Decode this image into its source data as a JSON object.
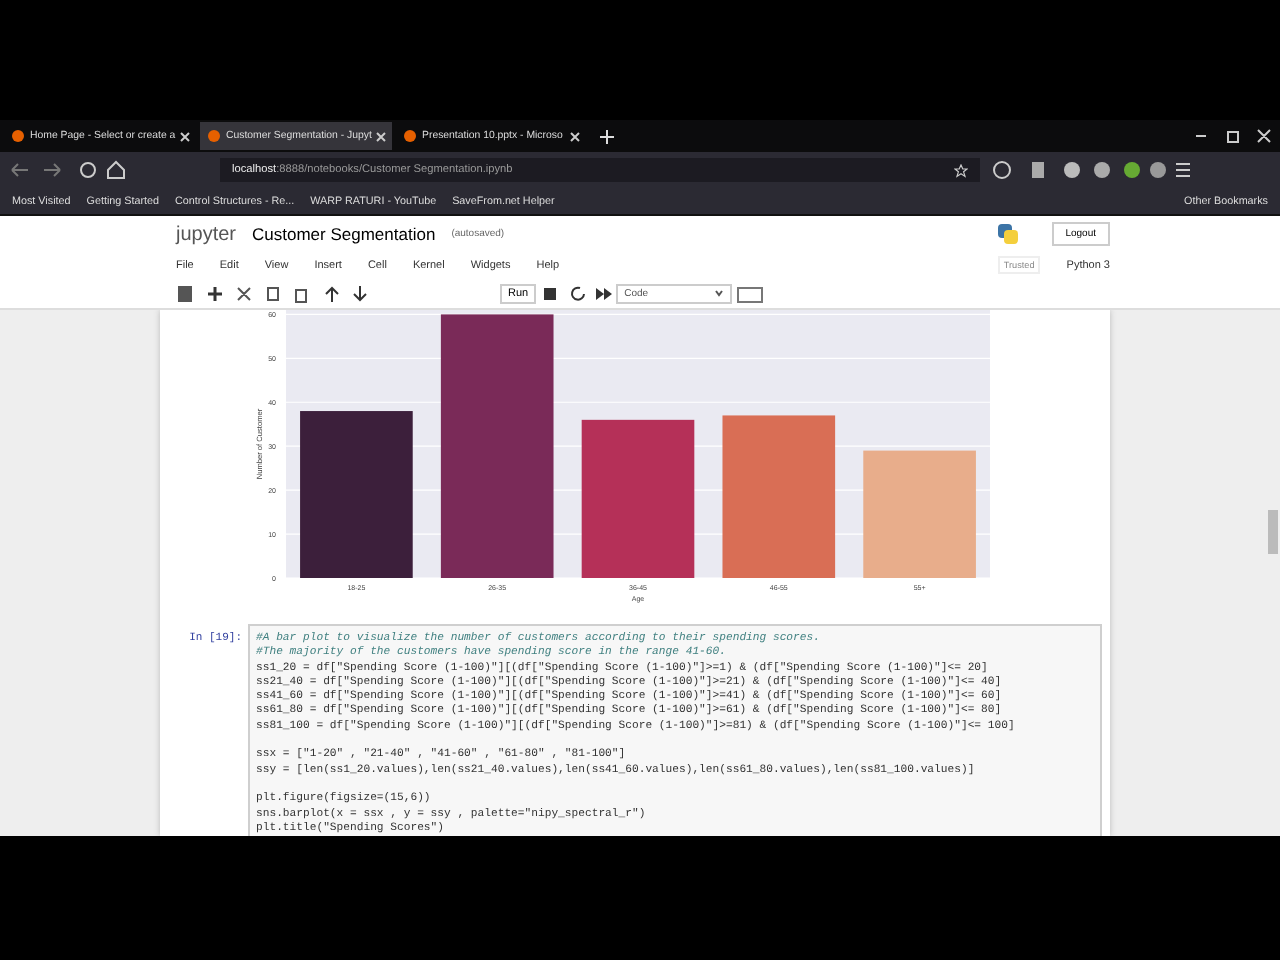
{
  "browser": {
    "tabs": [
      {
        "label": "Home Page - Select or create a",
        "selected": false
      },
      {
        "label": "Customer Segmentation - Jupyt",
        "selected": true
      },
      {
        "label": "Presentation 10.pptx - Microso",
        "selected": false
      }
    ],
    "address": {
      "host": "localhost",
      "path": ":8888/notebooks/Customer Segmentation.ipynb"
    },
    "bookmarks": [
      "Most Visited",
      "Getting Started",
      "Control Structures - Re...",
      "WARP RATURI - YouTube",
      "SaveFrom.net Helper"
    ],
    "other_bookmarks": "Other Bookmarks"
  },
  "jupyter": {
    "logo": "jupyter",
    "title": "Customer Segmentation",
    "autosave": "(autosaved)",
    "logout": "Logout",
    "menu": [
      "File",
      "Edit",
      "View",
      "Insert",
      "Cell",
      "Kernel",
      "Widgets",
      "Help"
    ],
    "run_label": "Run",
    "cell_type": "Code",
    "trusted": "Trusted",
    "kernel": "Python 3"
  },
  "output_chart": {
    "chart_data": {
      "type": "bar",
      "xlabel": "Age",
      "ylabel": "Number of Customer",
      "categories": [
        "18-25",
        "26-35",
        "36-45",
        "46-55",
        "55+"
      ],
      "values": [
        38,
        60,
        36,
        37,
        29
      ],
      "grid": true,
      "ylim": [
        0,
        61
      ],
      "yticks": [
        0,
        10,
        20,
        30,
        40,
        50,
        60
      ]
    }
  },
  "code_cell": {
    "prompt": "In [19]:",
    "lines": [
      {
        "kind": "comment",
        "text": "#A bar plot to visualize the number of customers according to their spending scores."
      },
      {
        "kind": "comment",
        "text": "#The majority of the customers have spending score in the range 41-60."
      },
      {
        "kind": "code",
        "text": "ss1_20 = df[\"Spending Score (1-100)\"][(df[\"Spending Score (1-100)\"]>=1) & (df[\"Spending Score (1-100)\"]<= 20]"
      },
      {
        "kind": "code",
        "text": "ss21_40 = df[\"Spending Score (1-100)\"][(df[\"Spending Score (1-100)\"]>=21) & (df[\"Spending Score (1-100)\"]<= 40]"
      },
      {
        "kind": "code",
        "text": "ss41_60 = df[\"Spending Score (1-100)\"][(df[\"Spending Score (1-100)\"]>=41) & (df[\"Spending Score (1-100)\"]<= 60]"
      },
      {
        "kind": "code",
        "text": "ss61_80 = df[\"Spending Score (1-100)\"][(df[\"Spending Score (1-100)\"]>=61) & (df[\"Spending Score (1-100)\"]<= 80]"
      },
      {
        "kind": "code",
        "text": "ss81_100 = df[\"Spending Score (1-100)\"][(df[\"Spending Score (1-100)\"]>=81) & (df[\"Spending Score (1-100)\"]<= 100]"
      },
      {
        "kind": "blank"
      },
      {
        "kind": "code",
        "text": "ssx = [\"1-20\" , \"21-40\" , \"41-60\" , \"61-80\" , \"81-100\"]"
      },
      {
        "kind": "code",
        "text": "ssy = [len(ss1_20.values),len(ss21_40.values),len(ss41_60.values),len(ss61_80.values),len(ss81_100.values)]"
      },
      {
        "kind": "blank"
      },
      {
        "kind": "code",
        "text": "plt.figure(figsize=(15,6))"
      },
      {
        "kind": "code",
        "text": "sns.barplot(x = ssx , y = ssy , palette=\"nipy_spectral_r\")"
      },
      {
        "kind": "code",
        "text": "plt.title(\"Spending Scores\")"
      }
    ]
  }
}
